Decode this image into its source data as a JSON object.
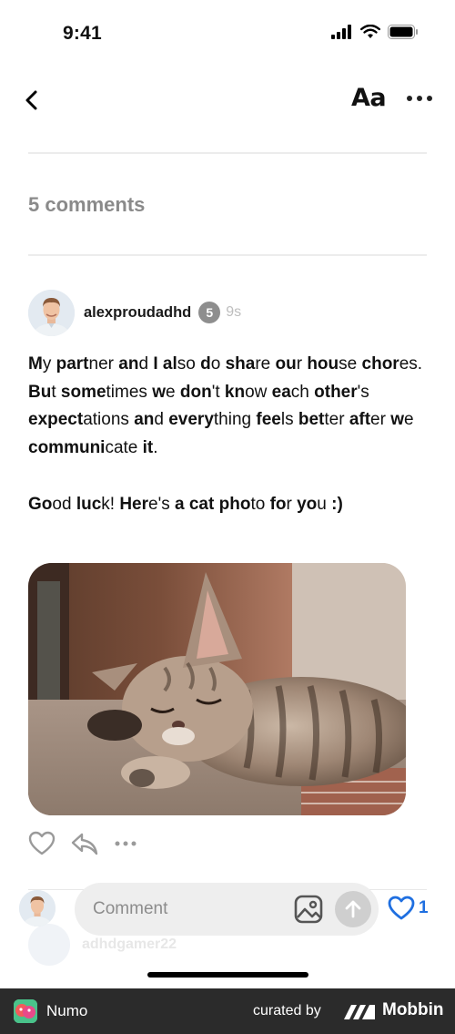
{
  "status_bar": {
    "time": "9:41",
    "icons": [
      "cellular-signal-icon",
      "wifi-icon",
      "battery-icon"
    ]
  },
  "nav": {
    "back_icon": "chevron-left-icon",
    "font_size_label": "Aa",
    "more_icon": "ellipsis-icon"
  },
  "comments_header": {
    "count_label": "5 comments"
  },
  "comment": {
    "username": "alexproudadhd",
    "level": "5",
    "time_ago": "9s",
    "body_paragraphs": [
      [
        {
          "b": "M",
          "r": "y "
        },
        {
          "b": "part",
          "r": "ner "
        },
        {
          "b": "an",
          "r": "d "
        },
        {
          "b": "I ",
          "r": ""
        },
        {
          "b": "al",
          "r": "so "
        },
        {
          "b": "d",
          "r": "o "
        },
        {
          "b": "sha",
          "r": "re "
        },
        {
          "b": "ou",
          "r": "r "
        },
        {
          "b": "hou",
          "r": "se "
        },
        {
          "b": "chor",
          "r": "es. "
        },
        {
          "b": "Bu",
          "r": "t "
        },
        {
          "b": "some",
          "r": "times "
        },
        {
          "b": "w",
          "r": "e "
        },
        {
          "b": "don",
          "r": "'t "
        },
        {
          "b": "kn",
          "r": "ow "
        },
        {
          "b": "ea",
          "r": "ch "
        },
        {
          "b": "other",
          "r": "'s "
        },
        {
          "b": "expect",
          "r": "ations "
        },
        {
          "b": "an",
          "r": "d "
        },
        {
          "b": "every",
          "r": "thing "
        },
        {
          "b": "fee",
          "r": "ls "
        },
        {
          "b": "bet",
          "r": "ter "
        },
        {
          "b": "aft",
          "r": "er "
        },
        {
          "b": "w",
          "r": "e "
        },
        {
          "b": "communi",
          "r": "cate "
        },
        {
          "b": "it",
          "r": "."
        }
      ],
      [
        {
          "b": "Go",
          "r": "od "
        },
        {
          "b": "luc",
          "r": "k! "
        },
        {
          "b": "Her",
          "r": "e's "
        },
        {
          "b": "a ",
          "r": ""
        },
        {
          "b": "cat ",
          "r": ""
        },
        {
          "b": "pho",
          "r": "to "
        },
        {
          "b": "fo",
          "r": "r "
        },
        {
          "b": "yo",
          "r": "u "
        },
        {
          "b": ":)",
          "r": ""
        }
      ]
    ],
    "photo_subject": "sleeping tabby kitten"
  },
  "actions": {
    "like_icon": "heart-outline-icon",
    "reply_icon": "reply-arrow-icon",
    "more_icon": "ellipsis-icon"
  },
  "composer": {
    "placeholder": "Comment",
    "image_icon": "image-icon",
    "send_icon": "arrow-up-icon",
    "like_count": "1",
    "ghost_username": "adhdgamer22"
  },
  "footer": {
    "app_name": "Numo",
    "curated_by": "curated by",
    "brand": "Mobbin"
  },
  "colors": {
    "accent_blue": "#1f6fe0",
    "muted_gray": "#8a8a8a",
    "badge_gray": "#8e8e8e",
    "input_bg": "#eeeeee",
    "footer_bg": "#2b2b2b"
  }
}
